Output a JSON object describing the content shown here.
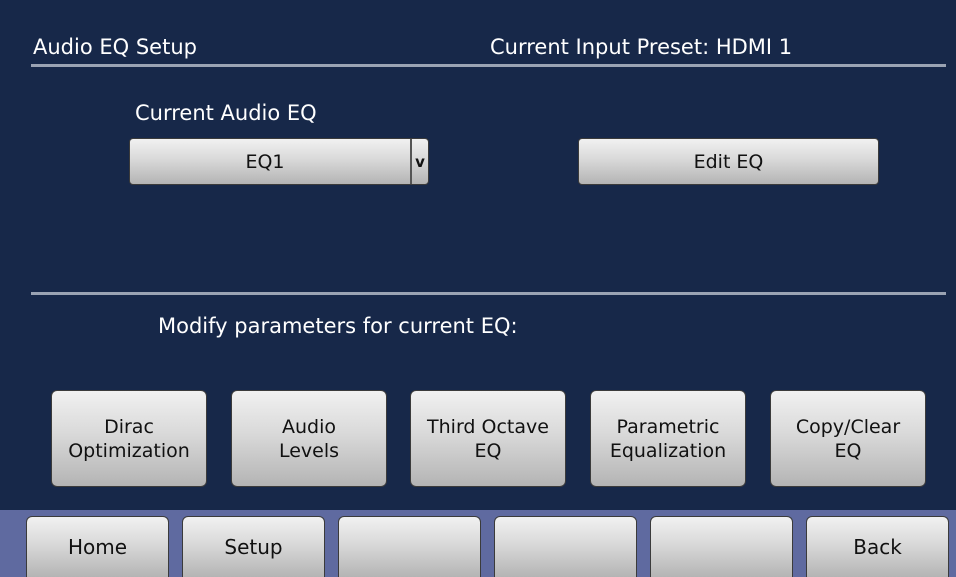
{
  "header": {
    "title": "Audio EQ Setup",
    "preset": "Current Input Preset: HDMI 1"
  },
  "current_eq": {
    "label": "Current Audio EQ",
    "selected": "EQ1",
    "arrow": "v",
    "edit_label": "Edit EQ"
  },
  "modify": {
    "label": "Modify parameters for current EQ:",
    "buttons": [
      {
        "line1": "Dirac",
        "line2": "Optimization"
      },
      {
        "line1": "Audio",
        "line2": "Levels"
      },
      {
        "line1": "Third Octave",
        "line2": "EQ"
      },
      {
        "line1": "Parametric",
        "line2": "Equalization"
      },
      {
        "line1": "Copy/Clear",
        "line2": "EQ"
      }
    ]
  },
  "nav": [
    "Home",
    "Setup",
    "",
    "",
    "",
    "Back"
  ]
}
